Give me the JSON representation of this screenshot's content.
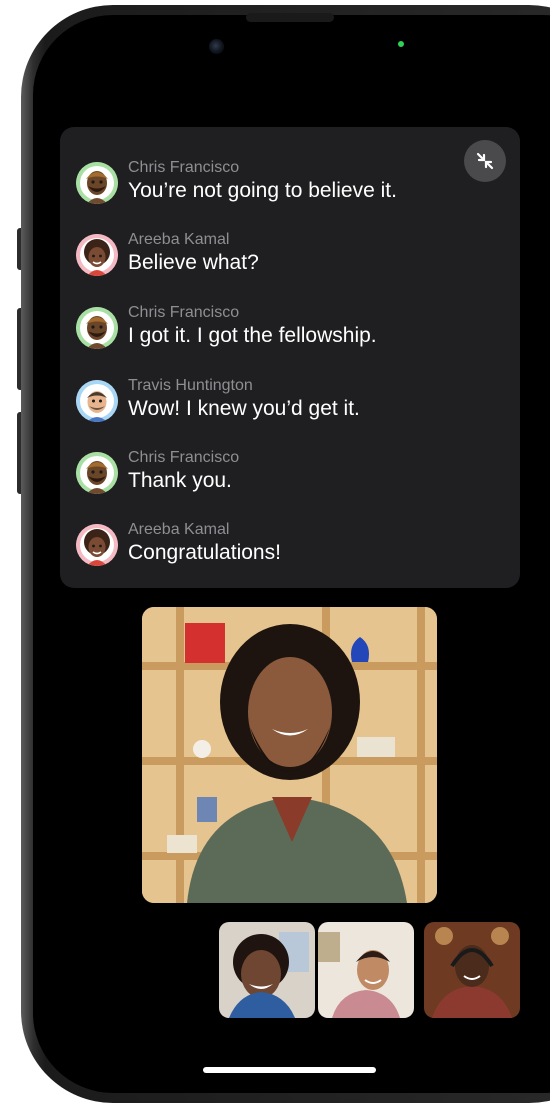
{
  "captions": [
    {
      "speaker": "Chris Francisco",
      "text": "You’re not going to believe it.",
      "avatar_icon": "memoji-chris-avatar-icon",
      "avatar_bg": "#a8e0a4"
    },
    {
      "speaker": "Areeba Kamal",
      "text": "Believe what?",
      "avatar_icon": "memoji-areeba-avatar-icon",
      "avatar_bg": "#f4b9c3"
    },
    {
      "speaker": "Chris Francisco",
      "text": "I got it. I got the fellowship.",
      "avatar_icon": "memoji-chris-avatar-icon",
      "avatar_bg": "#a8e0a4"
    },
    {
      "speaker": "Travis Huntington",
      "text": "Wow! I knew you’d get it.",
      "avatar_icon": "memoji-travis-avatar-icon",
      "avatar_bg": "#a9d6f5"
    },
    {
      "speaker": "Chris Francisco",
      "text": "Thank you.",
      "avatar_icon": "memoji-chris-avatar-icon",
      "avatar_bg": "#a8e0a4"
    },
    {
      "speaker": "Areeba Kamal",
      "text": "Congratulations!",
      "avatar_icon": "memoji-areeba-avatar-icon",
      "avatar_bg": "#f4b9c3"
    }
  ],
  "controls": {
    "collapse_icon": "collapse-arrows-icon"
  },
  "colors": {
    "panel_bg": "#1f1f21",
    "speaker_text": "#8e8e93",
    "message_text": "#ffffff",
    "screen_bg": "#000000",
    "mic_indicator": "#31d158"
  }
}
